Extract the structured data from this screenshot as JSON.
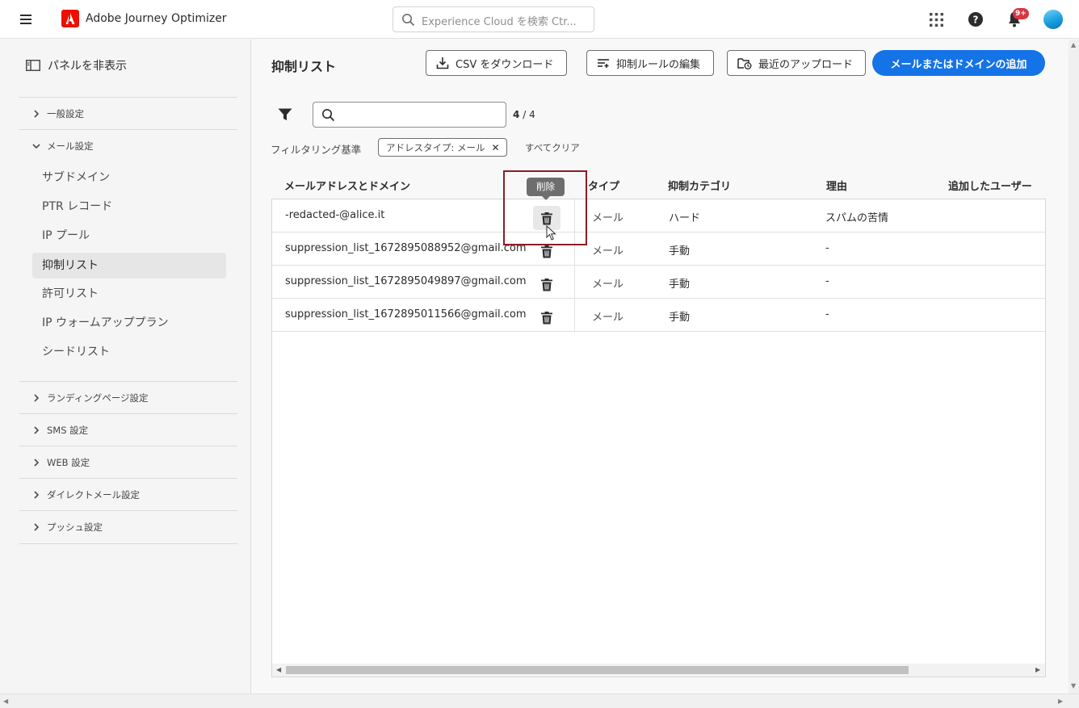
{
  "header": {
    "app_title": "Adobe Journey Optimizer",
    "search_placeholder": "Experience Cloud を検索 Ctr...",
    "notification_count": "9+",
    "brand_color": "#eb1000",
    "icons": [
      "menu-icon",
      "adobe-logo",
      "search-icon",
      "apps-grid-icon",
      "help-icon",
      "bell-icon",
      "avatar"
    ]
  },
  "sidebar": {
    "hide_panel_label": "パネルを非表示",
    "sections": {
      "general": "一般設定",
      "email": "メール設定",
      "landing": "ランディングページ設定",
      "sms": "SMS 設定",
      "web": "WEB 設定",
      "direct_mail": "ダイレクトメール設定",
      "push": "プッシュ設定"
    },
    "email_items": {
      "subdomain": "サブドメイン",
      "ptr": "PTR レコード",
      "ip_pool": "IP プール",
      "suppression": "抑制リスト",
      "allowlist": "許可リスト",
      "warmup": "IP ウォームアッププラン",
      "seed": "シードリスト"
    },
    "active_item": "抑制リスト"
  },
  "main": {
    "title": "抑制リスト",
    "buttons": {
      "download_csv": "CSV をダウンロード",
      "edit_rules": "抑制ルールの編集",
      "recent_uploads": "最近のアップロード",
      "add": "メールまたはドメインの追加"
    },
    "accent_color": "#1473e6",
    "count_current": "4",
    "count_sep": "/",
    "count_total": "4",
    "filter_label": "フィルタリング基準",
    "filter_chip": "アドレスタイプ: メール",
    "clear_all": "すべてクリア",
    "columns": {
      "email": "メールアドレスとドメイン",
      "type": "タイプ",
      "category": "抑制カテゴリ",
      "reason": "理由",
      "added_by": "追加したユーザー"
    },
    "rows": [
      {
        "email": "-redacted-@alice.it",
        "type": "メール",
        "category": "ハード",
        "reason": "スパムの苦情"
      },
      {
        "email": "suppression_list_1672895088952@gmail.com",
        "type": "メール",
        "category": "手動",
        "reason": "-"
      },
      {
        "email": "suppression_list_1672895049897@gmail.com",
        "type": "メール",
        "category": "手動",
        "reason": "-"
      },
      {
        "email": "suppression_list_1672895011566@gmail.com",
        "type": "メール",
        "category": "手動",
        "reason": "-"
      }
    ],
    "delete_tooltip": "削除",
    "highlight_color": "#8b1d24"
  }
}
